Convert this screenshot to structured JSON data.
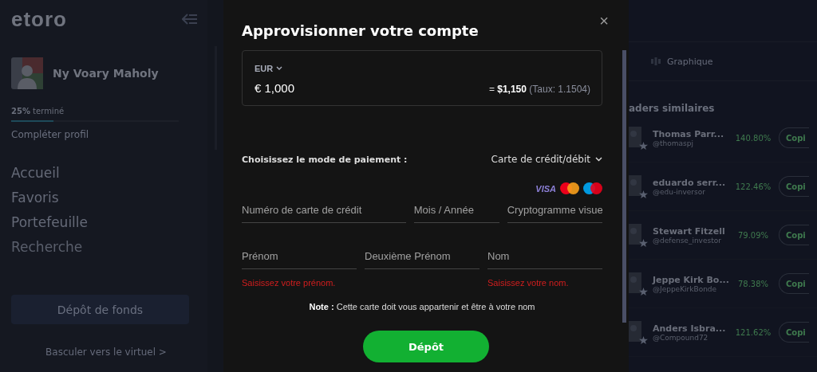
{
  "sidebar": {
    "logo": "etoro",
    "user": {
      "name": "Ny Voary Maholy"
    },
    "progress": {
      "label_strong": "25%",
      "label": "terminé",
      "level": 0.25
    },
    "complete_profile": "Compléter profil",
    "items": [
      "Accueil",
      "Favoris",
      "Portefeuille",
      "Recherche"
    ],
    "deposit_button": "Dépôt de fonds",
    "switch_link": "Basculer vers le virtuel >"
  },
  "background": {
    "tab": "Graphique",
    "section_title": "aders similaires",
    "traders": [
      {
        "name": "Thomas Parr...",
        "handle": "@thomaspj",
        "gain": "140.80%",
        "button": "Copi"
      },
      {
        "name": "eduardo serr...",
        "handle": "@edu-inversor",
        "gain": "122.46%",
        "button": "Copi"
      },
      {
        "name": "Stewart Fitzell",
        "handle": "@defense_investor",
        "gain": "79.09%",
        "button": "Copi"
      },
      {
        "name": "Jeppe Kirk Bo...",
        "handle": "@JeppeKirkBonde",
        "gain": "78.38%",
        "button": "Copi"
      },
      {
        "name": "Anders Isbra...",
        "handle": "@Compound72",
        "gain": "121.62%",
        "button": "Copi"
      }
    ]
  },
  "modal": {
    "title": "Approvisionner votre compte",
    "close": "×",
    "amount": {
      "currency": "EUR",
      "value": "€ 1,000",
      "converted_prefix": "=",
      "converted": "$1,150",
      "rate": "(Taux: 1.1504)"
    },
    "payment": {
      "label": "Choisissez le mode de paiement :",
      "method": "Carte de crédit/débit"
    },
    "card_logos": {
      "visa": "VISA"
    },
    "card_fields": [
      {
        "placeholder": "Numéro de carte de crédit"
      },
      {
        "placeholder": "Mois / Année"
      },
      {
        "placeholder": "Cryptogramme visue"
      }
    ],
    "name_fields": [
      {
        "placeholder": "Prénom",
        "error": "Saisissez votre prénom."
      },
      {
        "placeholder": "Deuxième Prénom"
      },
      {
        "placeholder": "Nom",
        "error": "Saisissez votre nom."
      }
    ],
    "note": "**Note :** Cette carte doit vous appartenir et être à votre nom",
    "submit": "Dépôt"
  }
}
